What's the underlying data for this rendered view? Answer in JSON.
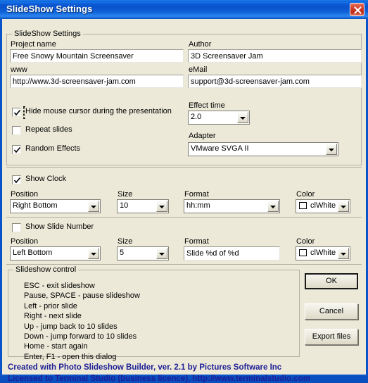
{
  "window": {
    "title": "SlideShow Settings",
    "close_icon": "close-icon"
  },
  "settings_group": {
    "legend": "SlideShow Settings",
    "project_name": {
      "label": "Project name",
      "value": "Free Snowy Mountain Screensaver"
    },
    "author": {
      "label": "Author",
      "value": "3D Screensaver Jam"
    },
    "www": {
      "label": "www",
      "value": "http://www.3d-screensaver-jam.com"
    },
    "email": {
      "label": "eMail",
      "value": "support@3d-screensaver-jam.com"
    },
    "hide_cursor": {
      "label": "Hide mouse cursor during the presentation",
      "checked": true
    },
    "repeat_slides": {
      "label": "Repeat slides",
      "checked": false
    },
    "random_effects": {
      "label": "Random Effects",
      "checked": true
    },
    "effect_time": {
      "label": "Effect time",
      "value": "2.0"
    },
    "adapter": {
      "label": "Adapter",
      "value": "VMware SVGA II"
    }
  },
  "clock": {
    "toggle": {
      "label": "Show Clock",
      "checked": true
    },
    "position": {
      "label": "Position",
      "value": "Right Bottom"
    },
    "size": {
      "label": "Size",
      "value": "10"
    },
    "format": {
      "label": "Format",
      "value": "hh:mm"
    },
    "color": {
      "label": "Color",
      "value": "clWhite",
      "swatch": "#ffffff"
    }
  },
  "slide_number": {
    "toggle": {
      "label": "Show Slide Number",
      "checked": false
    },
    "position": {
      "label": "Position",
      "value": "Left Bottom"
    },
    "size": {
      "label": "Size",
      "value": "5"
    },
    "format": {
      "label": "Format",
      "value": "Slide %d of %d"
    },
    "color": {
      "label": "Color",
      "value": "clWhite",
      "swatch": "#ffffff"
    }
  },
  "control_group": {
    "legend": "Slideshow control",
    "lines": [
      "ESC - exit slideshow",
      "Pause, SPACE - pause slideshow",
      "Left - prior slide",
      "Right - next slide",
      "Up - jump back to 10 slides",
      "Down - jump forward to 10 slides",
      "Home - start again",
      "Enter, F1 - open this dialog"
    ]
  },
  "buttons": {
    "ok": "OK",
    "cancel": "Cancel",
    "export": "Export files"
  },
  "footer": {
    "line1": "Created with Photo Slideshow Builder, ver. 2.1   by Pictures Software Inc",
    "line2": "Licensed to Terminal Studio (business licence), http://www.terminalstudio.com",
    "color": "#1d1d96"
  }
}
